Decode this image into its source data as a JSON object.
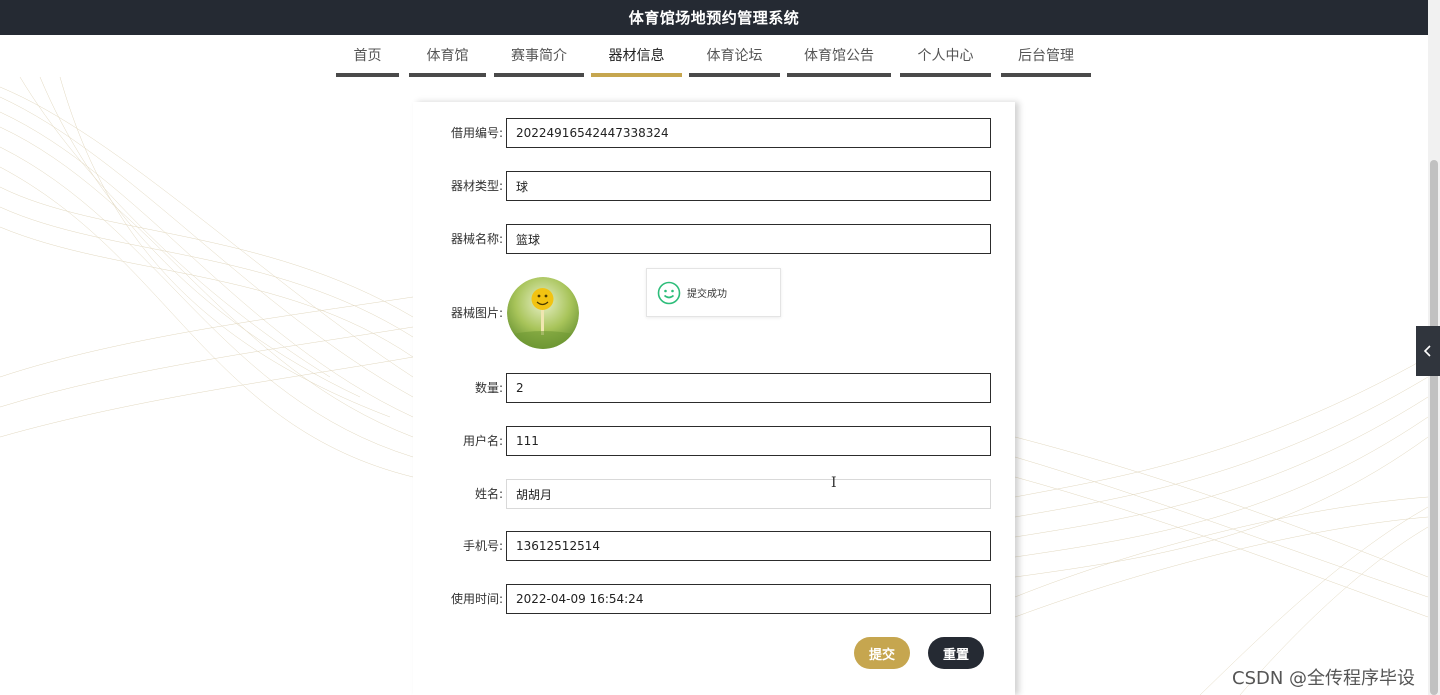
{
  "app": {
    "title": "体育馆场地预约管理系统"
  },
  "nav": {
    "items": [
      {
        "label": "首页"
      },
      {
        "label": "体育馆"
      },
      {
        "label": "赛事简介"
      },
      {
        "label": "器材信息"
      },
      {
        "label": "体育论坛"
      },
      {
        "label": "体育馆公告"
      },
      {
        "label": "个人中心"
      },
      {
        "label": "后台管理"
      }
    ],
    "active": "器材信息"
  },
  "form": {
    "credit_no": {
      "label": "借用编号:",
      "value": "20224916542447338324"
    },
    "equipment_type": {
      "label": "器材类型:",
      "value": "球"
    },
    "equipment_name": {
      "label": "器械名称:",
      "value": "篮球"
    },
    "equipment_image": {
      "label": "器械图片:",
      "icon": "smiley-ball-photo"
    },
    "quantity": {
      "label": "数量:",
      "value": "2"
    },
    "username": {
      "label": "用户名:",
      "value": "111"
    },
    "name": {
      "label": "姓名:",
      "value": "胡胡月"
    },
    "phone": {
      "label": "手机号:",
      "value": "13612512514"
    },
    "use_time": {
      "label": "使用时间:",
      "value": "2022-04-09 16:54:24"
    },
    "submit_label": "提交",
    "reset_label": "重置"
  },
  "toast": {
    "text": "提交成功",
    "icon": "smile-icon",
    "color": "#2dbd7a"
  },
  "watermark": "CSDN @全传程序毕设",
  "colors": {
    "topbar": "#252a33",
    "accent": "#c6a64f",
    "nav_underline": "#4a4a4a"
  }
}
